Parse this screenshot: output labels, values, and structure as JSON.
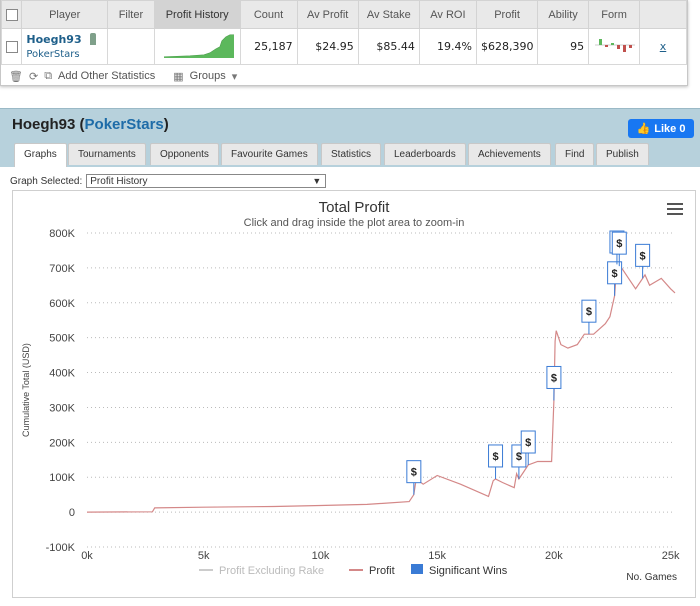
{
  "stats_table": {
    "headers": [
      "Player",
      "Filter",
      "Profit History",
      "Count",
      "Av Profit",
      "Av Stake",
      "Av ROI",
      "Profit",
      "Ability",
      "Form"
    ],
    "row": {
      "player": "Hoegh93",
      "site": "PokerStars",
      "count": "25,187",
      "av_profit": "$24.95",
      "av_stake": "$85.44",
      "av_roi": "19.4%",
      "profit": "$628,390",
      "ability": "95",
      "remove": "x"
    },
    "footer": {
      "add_stats": "Add Other Statistics",
      "groups": "Groups"
    }
  },
  "profile": {
    "name": "Hoegh93",
    "site": "PokerStars",
    "like_label": "Like 0",
    "tabs": [
      "Graphs",
      "Tournaments",
      "Opponents",
      "Favourite Games",
      "Statistics",
      "Leaderboards",
      "Achievements",
      "Find",
      "Publish"
    ],
    "active_tab": "Graphs",
    "graph_selected_label": "Graph Selected:",
    "graph_selected_value": "Profit History"
  },
  "colors": {
    "profit_line": "#d48888",
    "rake_line": "#cccccc",
    "marker": "#3a7bd5",
    "header_bg": "#b7d1dc",
    "like": "#1877f2"
  },
  "chart_data": {
    "type": "line",
    "title": "Total Profit",
    "subtitle": "Click and drag inside the plot area to zoom-in",
    "xlabel": "No. Games",
    "ylabel": "Cumulative Total (USD)",
    "xlim": [
      0,
      25187
    ],
    "ylim": [
      -100000,
      800000
    ],
    "x_ticks": [
      "0k",
      "5k",
      "10k",
      "15k",
      "20k",
      "25k"
    ],
    "y_ticks": [
      "-100K",
      "0",
      "100K",
      "200K",
      "300K",
      "400K",
      "500K",
      "600K",
      "700K",
      "800K"
    ],
    "legend": [
      "Profit Excluding Rake",
      "Profit",
      "Significant Wins"
    ],
    "series": [
      {
        "name": "Profit",
        "points": [
          [
            0,
            0
          ],
          [
            2800,
            1000
          ],
          [
            2900,
            12000
          ],
          [
            5000,
            14000
          ],
          [
            8000,
            16000
          ],
          [
            10000,
            19000
          ],
          [
            12000,
            22000
          ],
          [
            13800,
            30000
          ],
          [
            14000,
            50000
          ],
          [
            14100,
            95000
          ],
          [
            14400,
            80000
          ],
          [
            15000,
            105000
          ],
          [
            16000,
            80000
          ],
          [
            17200,
            45000
          ],
          [
            17400,
            90000
          ],
          [
            17500,
            95000
          ],
          [
            17800,
            85000
          ],
          [
            18300,
            70000
          ],
          [
            18400,
            110000
          ],
          [
            18500,
            95000
          ],
          [
            18700,
            115000
          ],
          [
            18900,
            135000
          ],
          [
            19300,
            145000
          ],
          [
            19900,
            145000
          ],
          [
            20000,
            320000
          ],
          [
            20050,
            490000
          ],
          [
            20100,
            520000
          ],
          [
            20300,
            480000
          ],
          [
            20600,
            470000
          ],
          [
            21000,
            480000
          ],
          [
            21300,
            510000
          ],
          [
            21700,
            510000
          ],
          [
            22200,
            540000
          ],
          [
            22400,
            560000
          ],
          [
            22600,
            620000
          ],
          [
            22700,
            710000
          ],
          [
            22900,
            700000
          ],
          [
            23200,
            670000
          ],
          [
            23500,
            640000
          ],
          [
            23900,
            680000
          ],
          [
            24100,
            650000
          ],
          [
            24600,
            670000
          ],
          [
            25000,
            640000
          ],
          [
            25187,
            628390
          ]
        ]
      }
    ],
    "significant_wins_x": [
      14000,
      17500,
      18500,
      18900,
      20000,
      21500,
      22600,
      22700,
      22800,
      23800
    ]
  }
}
